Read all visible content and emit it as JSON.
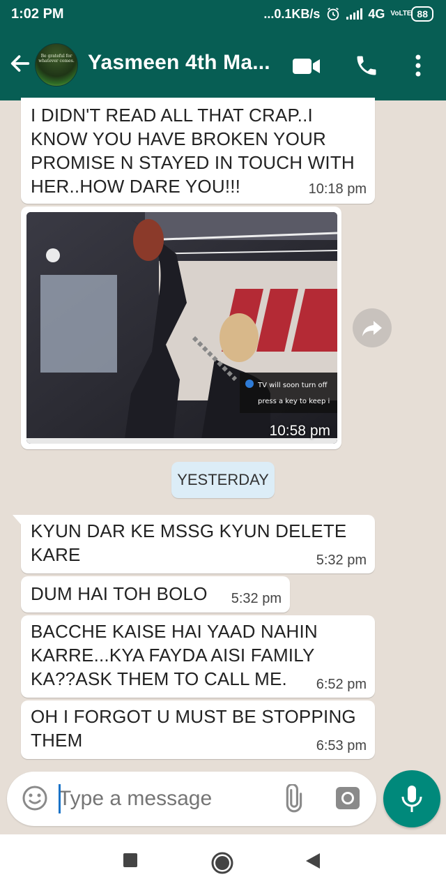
{
  "status": {
    "time": "1:02 PM",
    "network_speed": "...0.1KB/s",
    "network_type": "4G",
    "volte": "VoLTE",
    "battery": "88"
  },
  "header": {
    "contact_name": "Yasmeen 4th Ma...",
    "avatar_text": "Be grateful for whatever comes."
  },
  "messages": [
    {
      "text": "I DIDN'T READ ALL THAT CRAP..I\nKNOW YOU HAVE BROKEN YOUR\nPROMISE N STAYED IN TOUCH WITH\nHER..HOW DARE YOU!!!",
      "time": "10:18 pm"
    },
    {
      "type": "image",
      "time": "10:58 pm",
      "overlay_line1": "TV will soon turn off",
      "overlay_line2": "press a key to keep i"
    },
    {
      "text": "KYUN DAR KE MSSG KYUN DELETE\nKARE",
      "time": "5:32 pm"
    },
    {
      "text": "DUM HAI TOH BOLO",
      "time": "5:32 pm"
    },
    {
      "text": "BACCHE KAISE HAI YAAD NAHIN\nKARRE...KYA FAYDA AISI FAMILY\nKA??ASK THEM TO CALL ME.",
      "time": "6:52 pm"
    },
    {
      "text": "OH I FORGOT U MUST BE STOPPING\nTHEM",
      "time": "6:53 pm"
    }
  ],
  "date_divider": "YESTERDAY",
  "composer": {
    "placeholder": "Type a message"
  },
  "icons": {
    "back": "arrow-left-icon",
    "video": "video-call-icon",
    "phone": "phone-call-icon",
    "menu": "more-vert-icon",
    "forward": "forward-icon",
    "emoji": "emoji-icon",
    "attach": "paperclip-icon",
    "camera": "camera-icon",
    "mic": "mic-icon"
  },
  "colors": {
    "header": "#075e54",
    "chat_background": "#e6ded6",
    "mic_button": "#00897b",
    "date_chip": "#dcedf7"
  }
}
